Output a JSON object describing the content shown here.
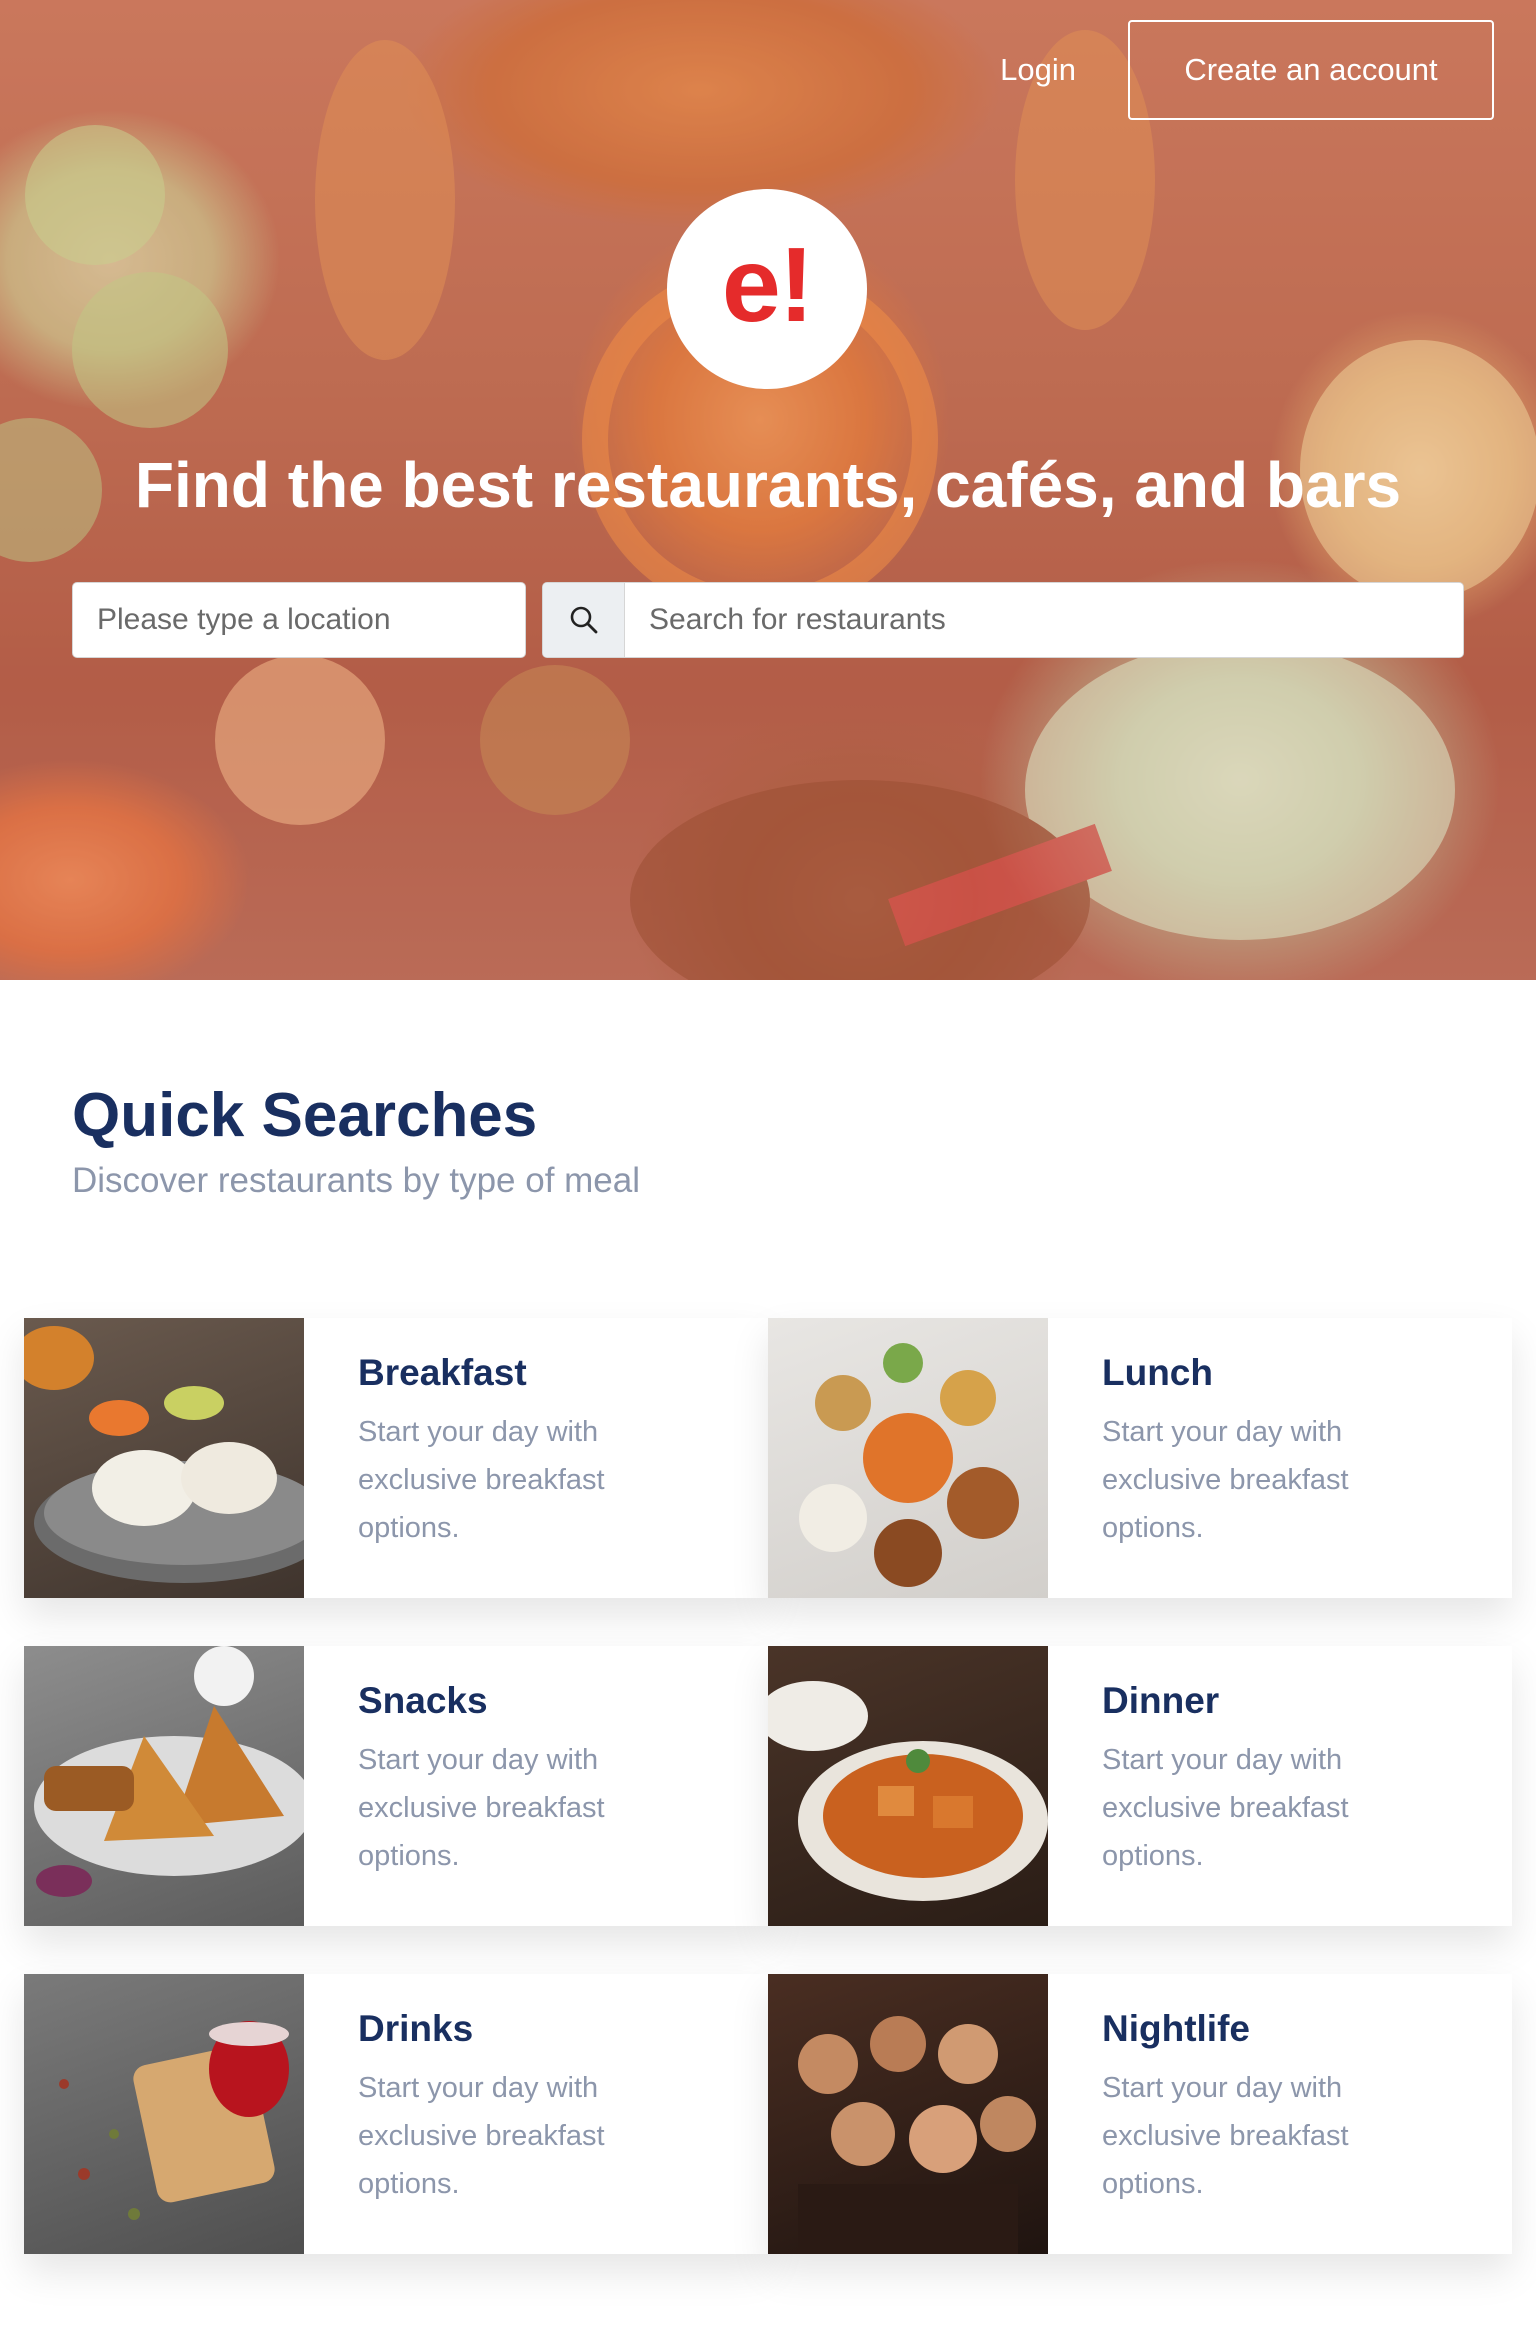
{
  "nav": {
    "login_label": "Login",
    "create_account_label": "Create an account"
  },
  "logo": {
    "text": "e!"
  },
  "hero": {
    "title": "Find the best restaurants, cafés, and bars"
  },
  "search": {
    "location_placeholder": "Please type a location",
    "restaurant_placeholder": "Search for restaurants"
  },
  "quick_searches": {
    "title": "Quick Searches",
    "subtitle": "Discover restaurants by type of meal",
    "cards": [
      {
        "title": "Breakfast",
        "description": "Start your day with exclusive breakfast options."
      },
      {
        "title": "Lunch",
        "description": "Start your day with exclusive breakfast options."
      },
      {
        "title": "Snacks",
        "description": "Start your day with exclusive breakfast options."
      },
      {
        "title": "Dinner",
        "description": "Start your day with exclusive breakfast options."
      },
      {
        "title": "Drinks",
        "description": "Start your day with exclusive breakfast options."
      },
      {
        "title": "Nightlife",
        "description": "Start your day with exclusive breakfast options."
      }
    ]
  },
  "colors": {
    "brand_red": "#e52b2b",
    "heading_navy": "#192f60",
    "muted_text": "#8c96ab"
  }
}
